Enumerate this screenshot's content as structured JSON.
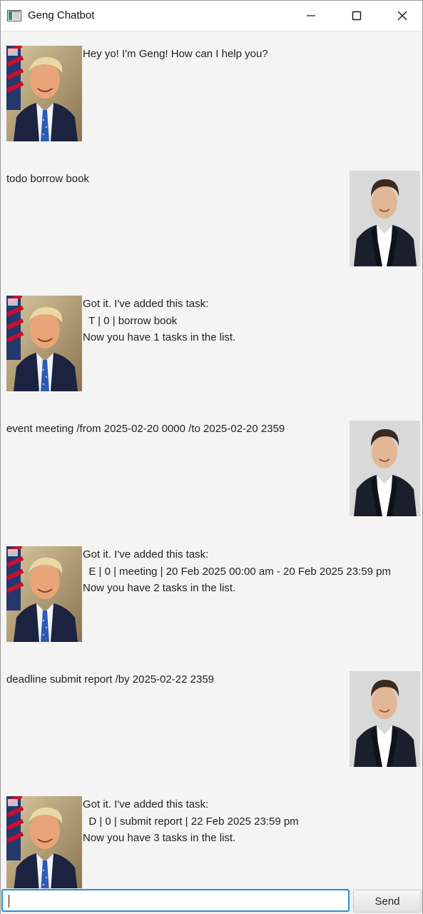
{
  "window": {
    "title": "Geng Chatbot",
    "icon": "app-window-icon",
    "controls": [
      "minimize-icon",
      "maximize-icon",
      "close-icon"
    ]
  },
  "messages": [
    {
      "from": "bot",
      "avatar": "bot-avatar-portrait",
      "text": "Hey yo! I'm Geng! How can I help you?"
    },
    {
      "from": "user",
      "avatar": "user-avatar-portrait",
      "text": "todo borrow book"
    },
    {
      "from": "bot",
      "avatar": "bot-avatar-portrait",
      "text": "Got it. I've added this task:\n  T | 0 | borrow book\nNow you have 1 tasks in the list."
    },
    {
      "from": "user",
      "avatar": "user-avatar-portrait",
      "text": "event meeting /from 2025-02-20 0000 /to 2025-02-20 2359"
    },
    {
      "from": "bot",
      "avatar": "bot-avatar-portrait",
      "text": "Got it. I've added this task:\n  E | 0 | meeting | 20 Feb 2025 00:00 am - 20 Feb 2025 23:59 pm\nNow you have 2 tasks in the list."
    },
    {
      "from": "user",
      "avatar": "user-avatar-portrait",
      "text": "deadline submit report /by 2025-02-22 2359"
    },
    {
      "from": "bot",
      "avatar": "bot-avatar-portrait",
      "text": "Got it. I've added this task:\n  D | 0 | submit report | 22 Feb 2025 23:59 pm\nNow you have 3 tasks in the list."
    }
  ],
  "input": {
    "value": "",
    "placeholder": ""
  },
  "send_button": {
    "label": "Send"
  },
  "colors": {
    "background": "#f4f4f4",
    "input_focus_border": "#2a8fd6",
    "text": "#1f1f1f"
  }
}
